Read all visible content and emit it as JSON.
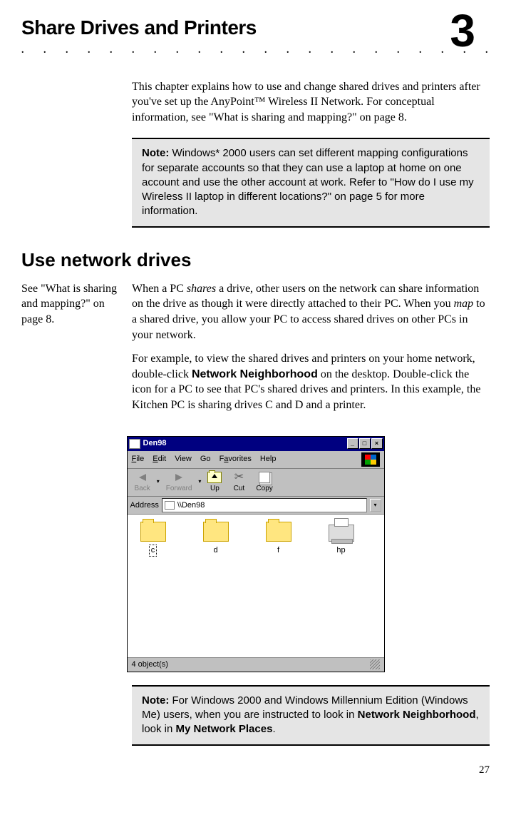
{
  "chapter": {
    "title": "Share Drives and Printers",
    "number": "3"
  },
  "intro": "This chapter explains how to use and change shared drives and printers after you've set up the AnyPoint™ Wireless II Network. For conceptual information, see \"What is sharing and mapping?\" on page 8.",
  "note1": {
    "label": "Note:",
    "text": "Windows* 2000 users can set different mapping configurations for separate accounts so that they can use a laptop at home on one account and use the other account at work. Refer to \"How do I use my Wireless II laptop in different locations?\" on page 5 for more information."
  },
  "section_heading": "Use network drives",
  "sidebar_note": "See \"What is sharing and mapping?\" on page 8.",
  "para1": {
    "pre": "When a PC ",
    "i1": "shares",
    "mid": " a drive, other users on the network can share information on the drive as though it were directly attached to their PC. When you ",
    "i2": "map",
    "post": " to a shared drive, you allow your PC to access shared drives on other PCs in your network."
  },
  "para2": {
    "pre": "For example, to view the shared drives and printers on your home network, double-click ",
    "b1": "Network Neighborhood",
    "post": " on the desktop. Double-click the icon for a PC to see that PC's shared drives and printers. In this example, the Kitchen PC is sharing drives C and D and a printer."
  },
  "window": {
    "title": "Den98",
    "menus": {
      "file": "File",
      "edit": "Edit",
      "view": "View",
      "go": "Go",
      "favorites": "Favorites",
      "help": "Help"
    },
    "toolbar": {
      "back": "Back",
      "forward": "Forward",
      "up": "Up",
      "cut": "Cut",
      "copy": "Copy"
    },
    "address_label": "Address",
    "address_value": "\\\\Den98",
    "items": {
      "c": "c",
      "d": "d",
      "f": "f",
      "hp": "hp"
    },
    "status": "4 object(s)"
  },
  "note2": {
    "label": "Note:",
    "pre": "For Windows 2000 and Windows Millennium Edition (Windows Me) users, when you are instructed to look in ",
    "b1": "Network Neighborhood",
    "mid": ", look in ",
    "b2": "My Network Places",
    "post": "."
  },
  "page_number": "27"
}
